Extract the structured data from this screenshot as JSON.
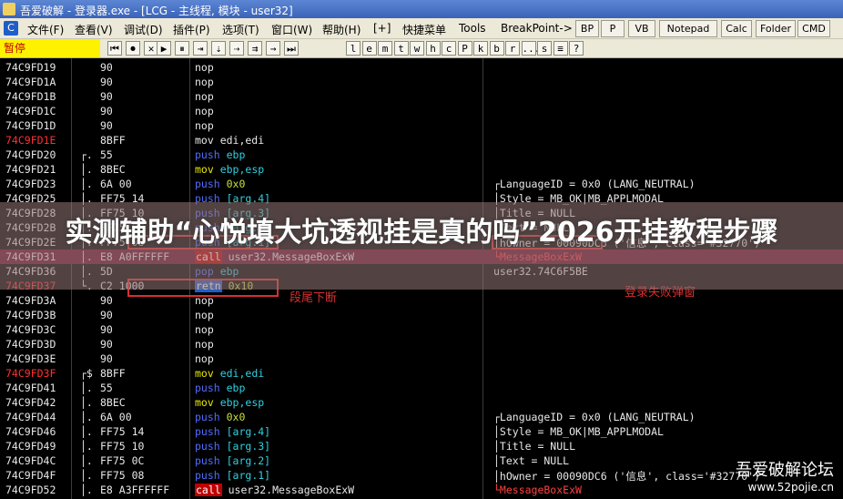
{
  "window": {
    "title": "吾爱破解 - 登录器.exe - [LCG - 主线程, 模块 - user32]"
  },
  "menu": {
    "logo": "C",
    "items": [
      "文件(F)",
      "查看(V)",
      "调试(D)",
      "插件(P)",
      "选项(T)",
      "窗口(W)",
      "帮助(H)",
      "[+]",
      "快捷菜单",
      "Tools",
      "BreakPoint->"
    ],
    "tabs": [
      "BP",
      "P",
      "VB",
      "Notepad",
      "Calc",
      "Folder",
      "CMD"
    ]
  },
  "toolbar": {
    "status": "暂停",
    "buttons": [
      "⏮",
      "⏺",
      "✕",
      "▶",
      "⏸",
      "⇥",
      "⇣",
      "⇢",
      "⇉",
      "→",
      "⏭",
      "l",
      "e",
      "m",
      "t",
      "w",
      "h",
      "c",
      "P",
      "k",
      "b",
      "r",
      "...",
      "s",
      "≡",
      "?"
    ]
  },
  "cpu_rows": [
    {
      "addr": "74C9FD19",
      "mark": "",
      "hex": "90",
      "asm": [
        {
          "t": "nop",
          "c": "kw-nop"
        }
      ],
      "cmt": ""
    },
    {
      "addr": "74C9FD1A",
      "mark": "",
      "hex": "90",
      "asm": [
        {
          "t": "nop",
          "c": "kw-nop"
        }
      ],
      "cmt": ""
    },
    {
      "addr": "74C9FD1B",
      "mark": "",
      "hex": "90",
      "asm": [
        {
          "t": "nop",
          "c": "kw-nop"
        }
      ],
      "cmt": ""
    },
    {
      "addr": "74C9FD1C",
      "mark": "",
      "hex": "90",
      "asm": [
        {
          "t": "nop",
          "c": "kw-nop"
        }
      ],
      "cmt": ""
    },
    {
      "addr": "74C9FD1D",
      "mark": "",
      "hex": "90",
      "asm": [
        {
          "t": "nop",
          "c": "kw-nop"
        }
      ],
      "cmt": ""
    },
    {
      "addr": "74C9FD1E",
      "red": true,
      "mark": "",
      "hex": "8BFF",
      "asm": [
        {
          "t": "mov edi,edi",
          "c": "kw-nop"
        }
      ],
      "cmt": ""
    },
    {
      "addr": "74C9FD20",
      "mark": "┌.",
      "hex": "55",
      "asm": [
        {
          "t": "push ",
          "c": "kw-push"
        },
        {
          "t": "ebp",
          "c": "arg-cyan"
        }
      ],
      "cmt": ""
    },
    {
      "addr": "74C9FD21",
      "mark": "│.",
      "hex": "8BEC",
      "asm": [
        {
          "t": "mov ",
          "c": "kw-mov"
        },
        {
          "t": "ebp,esp",
          "c": "arg-cyan"
        }
      ],
      "cmt": ""
    },
    {
      "addr": "74C9FD23",
      "mark": "│.",
      "hex": "6A 00",
      "asm": [
        {
          "t": "push ",
          "c": "kw-push"
        },
        {
          "t": "0x0",
          "c": "arg-grn"
        }
      ],
      "cmt": "┌LanguageID = 0x0 (LANG_NEUTRAL)"
    },
    {
      "addr": "74C9FD25",
      "mark": "│.",
      "hex": "FF75 14",
      "asm": [
        {
          "t": "push ",
          "c": "kw-push"
        },
        {
          "t": "[arg.4]",
          "c": "arg-cyan"
        }
      ],
      "cmt": "│Style = MB_OK|MB_APPLMODAL"
    },
    {
      "addr": "74C9FD28",
      "mark": "│.",
      "hex": "FF75 10",
      "asm": [
        {
          "t": "push ",
          "c": "kw-push"
        },
        {
          "t": "[arg.3]",
          "c": "arg-cyan"
        }
      ],
      "cmt": "│Title = NULL"
    },
    {
      "addr": "74C9FD2B",
      "mark": "│.",
      "hex": "FF75 0C",
      "asm": [
        {
          "t": "push ",
          "c": "kw-push"
        },
        {
          "t": "[arg.2]",
          "c": "arg-cyan"
        }
      ],
      "cmt": "│Text = NULL"
    },
    {
      "addr": "74C9FD2E",
      "mark": "│.",
      "hex": "FF75 08",
      "asm": [
        {
          "t": "push ",
          "c": "kw-push"
        },
        {
          "t": "[arg.1]",
          "c": "arg-cyan"
        }
      ],
      "cmt": "│hOwner = 00090DC6 ('信息', class='#32770')"
    },
    {
      "addr": "74C9FD31",
      "mark": "│.",
      "hex": "E8 A0FFFFFF",
      "asm": [
        {
          "t": "call",
          "c": "kw-call"
        },
        {
          "t": " user32.MessageBoxExW",
          "c": "arg-plain"
        }
      ],
      "cmt": "└MessageBoxExW",
      "cmtRed": true,
      "hl": "#6a1030"
    },
    {
      "addr": "74C9FD36",
      "mark": "│.",
      "hex": "5D",
      "asm": [
        {
          "t": "pop ",
          "c": "kw-push"
        },
        {
          "t": "ebp",
          "c": "arg-cyan"
        }
      ],
      "cmt": "user32.74C6F5BE"
    },
    {
      "addr": "74C9FD37",
      "red": true,
      "mark": "└.",
      "hex": "C2 1000",
      "asm": [
        {
          "t": "retn",
          "c": "kw-retn"
        },
        {
          "t": " 0x10",
          "c": "arg-grn"
        }
      ],
      "cmt": ""
    },
    {
      "addr": "74C9FD3A",
      "mark": "",
      "hex": "90",
      "asm": [
        {
          "t": "nop",
          "c": "kw-nop"
        }
      ],
      "cmt": ""
    },
    {
      "addr": "74C9FD3B",
      "mark": "",
      "hex": "90",
      "asm": [
        {
          "t": "nop",
          "c": "kw-nop"
        }
      ],
      "cmt": ""
    },
    {
      "addr": "74C9FD3C",
      "mark": "",
      "hex": "90",
      "asm": [
        {
          "t": "nop",
          "c": "kw-nop"
        }
      ],
      "cmt": ""
    },
    {
      "addr": "74C9FD3D",
      "mark": "",
      "hex": "90",
      "asm": [
        {
          "t": "nop",
          "c": "kw-nop"
        }
      ],
      "cmt": ""
    },
    {
      "addr": "74C9FD3E",
      "mark": "",
      "hex": "90",
      "asm": [
        {
          "t": "nop",
          "c": "kw-nop"
        }
      ],
      "cmt": ""
    },
    {
      "addr": "74C9FD3F",
      "red": true,
      "mark": "┌$",
      "hex": "8BFF",
      "asm": [
        {
          "t": "mov ",
          "c": "kw-mov"
        },
        {
          "t": "edi,edi",
          "c": "arg-cyan"
        }
      ],
      "cmt": ""
    },
    {
      "addr": "74C9FD41",
      "mark": "│.",
      "hex": "55",
      "asm": [
        {
          "t": "push ",
          "c": "kw-push"
        },
        {
          "t": "ebp",
          "c": "arg-cyan"
        }
      ],
      "cmt": ""
    },
    {
      "addr": "74C9FD42",
      "mark": "│.",
      "hex": "8BEC",
      "asm": [
        {
          "t": "mov ",
          "c": "kw-mov"
        },
        {
          "t": "ebp,esp",
          "c": "arg-cyan"
        }
      ],
      "cmt": ""
    },
    {
      "addr": "74C9FD44",
      "mark": "│.",
      "hex": "6A 00",
      "asm": [
        {
          "t": "push ",
          "c": "kw-push"
        },
        {
          "t": "0x0",
          "c": "arg-grn"
        }
      ],
      "cmt": "┌LanguageID = 0x0 (LANG_NEUTRAL)"
    },
    {
      "addr": "74C9FD46",
      "mark": "│.",
      "hex": "FF75 14",
      "asm": [
        {
          "t": "push ",
          "c": "kw-push"
        },
        {
          "t": "[arg.4]",
          "c": "arg-cyan"
        }
      ],
      "cmt": "│Style = MB_OK|MB_APPLMODAL"
    },
    {
      "addr": "74C9FD49",
      "mark": "│.",
      "hex": "FF75 10",
      "asm": [
        {
          "t": "push ",
          "c": "kw-push"
        },
        {
          "t": "[arg.3]",
          "c": "arg-cyan"
        }
      ],
      "cmt": "│Title = NULL"
    },
    {
      "addr": "74C9FD4C",
      "mark": "│.",
      "hex": "FF75 0C",
      "asm": [
        {
          "t": "push ",
          "c": "kw-push"
        },
        {
          "t": "[arg.2]",
          "c": "arg-cyan"
        }
      ],
      "cmt": "│Text = NULL"
    },
    {
      "addr": "74C9FD4F",
      "mark": "│.",
      "hex": "FF75 08",
      "asm": [
        {
          "t": "push ",
          "c": "kw-push"
        },
        {
          "t": "[arg.1]",
          "c": "arg-cyan"
        }
      ],
      "cmt": "│hOwner = 00090DC6 ('信息', class='#32770')"
    },
    {
      "addr": "74C9FD52",
      "mark": "│.",
      "hex": "E8 A3FFFFFF",
      "asm": [
        {
          "t": "call",
          "c": "kw-call"
        },
        {
          "t": " user32.MessageBoxExW",
          "c": "arg-plain"
        }
      ],
      "cmt": "└MessageBoxExW",
      "cmtRed": true
    }
  ],
  "annotations": {
    "segment_end": "段尾下断",
    "login_fail": "登录失败弹窗"
  },
  "overlay": {
    "title": "实测辅助“心悦填大坑透视挂是真的吗”2026开挂教程步骤"
  },
  "watermark": {
    "line1": "吾爱破解论坛",
    "line2": "www.52pojie.cn"
  }
}
